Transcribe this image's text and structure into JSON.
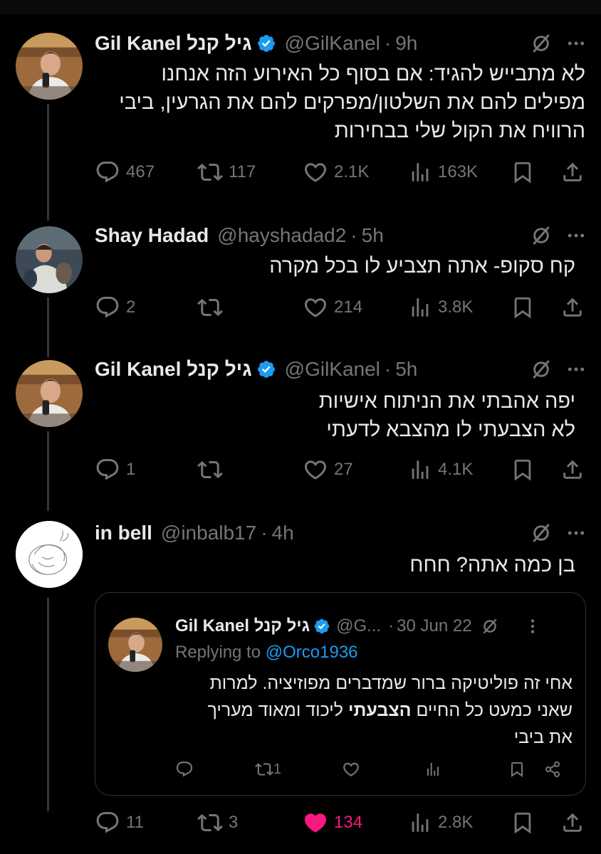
{
  "tweets": [
    {
      "name": "Gil Kanel גיל קנל",
      "handle": "@GilKanel",
      "time": "9h",
      "lines": [
        "לא מתבייש להגיד: אם בסוף כל האירוע הזה  אנחנו",
        "מפילים להם את השלטון/מפרקים להם את הגרעין, ביבי",
        "הרוויח את הקול שלי בבחירות"
      ],
      "replies": "467",
      "reposts": "117",
      "likes": "2.1K",
      "views": "163K"
    },
    {
      "name": "Shay Hadad",
      "handle": "@hayshadad2",
      "time": "5h",
      "lines": [
        "קח סקופ- אתה תצביע לו בכל מקרה"
      ],
      "replies": "2",
      "reposts": "",
      "likes": "214",
      "views": "3.8K"
    },
    {
      "name": "Gil Kanel גיל קנל",
      "handle": "@GilKanel",
      "time": "5h",
      "lines": [
        "יפה אהבתי את הניתוח אישיות",
        "לא הצבעתי לו מהצבא לדעתי"
      ],
      "replies": "1",
      "reposts": "",
      "likes": "27",
      "views": "4.1K"
    },
    {
      "name": "in bell",
      "handle": "@inbalb17",
      "time": "4h",
      "lines": [
        "בן כמה אתה? חחח"
      ],
      "replies": "11",
      "reposts": "3",
      "likes": "134",
      "views": "2.8K"
    }
  ],
  "quote": {
    "name": "Gil Kanel גיל קנל",
    "handle": "@G...",
    "time": "30 Jun 22",
    "replying_prefix": "Replying to ",
    "replying_to": "@Orco1936",
    "line1": "אחי זה פוליטיקה ברור שמדברים מפוזיציה. למרות",
    "line2_pre": "שאני כמעט כל החיים ",
    "line2_bold": "הצבעתי",
    "line2_post": " ליכוד ומאוד מעריך",
    "line3": "את ביבי",
    "reposts": "1"
  },
  "separator": "·",
  "colors": {
    "background": "#000000",
    "muted": "#71767b",
    "verified": "#1d9bf0",
    "like_active": "#f91880",
    "text": "#e7e9ea"
  }
}
